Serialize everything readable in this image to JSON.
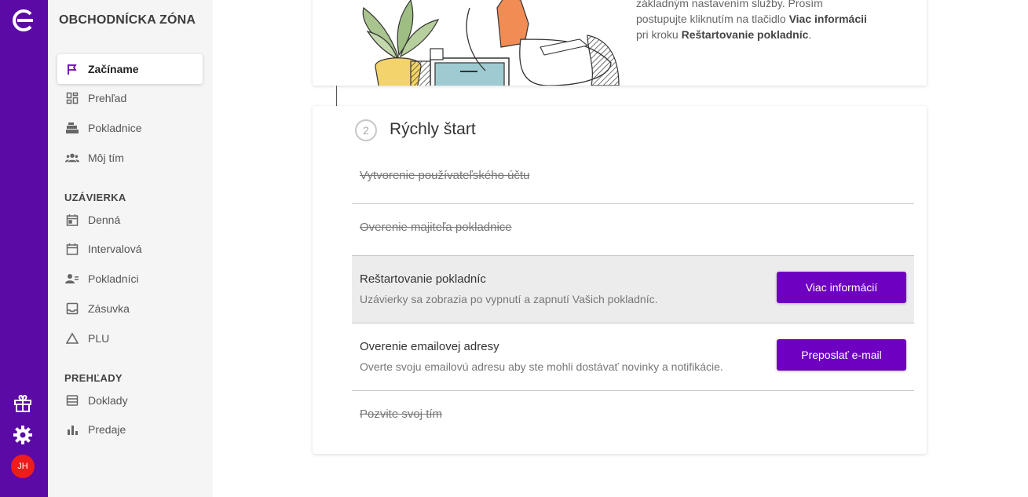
{
  "rail": {
    "icons": [
      "logo-icon",
      "gift-icon",
      "gear-icon"
    ],
    "avatar_initials": "JH",
    "avatar_color": "#ee1c1c",
    "rail_color": "#5b0aa6"
  },
  "sidebar": {
    "title": "OBCHODNÍCKA ZÓNA",
    "main_items": [
      {
        "label": "Začíname",
        "icon": "flag-icon",
        "active": true
      },
      {
        "label": "Prehľad",
        "icon": "dashboard-icon"
      },
      {
        "label": "Pokladnice",
        "icon": "cash-register-icon"
      },
      {
        "label": "Môj tím",
        "icon": "team-icon"
      }
    ],
    "closing_title": "UZÁVIERKA",
    "closing_items": [
      {
        "label": "Denná",
        "icon": "calendar-icon"
      },
      {
        "label": "Intervalová",
        "icon": "calendar-range-icon"
      },
      {
        "label": "Pokladníci",
        "icon": "cashiers-icon"
      },
      {
        "label": "Zásuvka",
        "icon": "drawer-icon"
      },
      {
        "label": "PLU",
        "icon": "triangle-icon"
      }
    ],
    "reports_title": "PREHĽADY",
    "reports_items": [
      {
        "label": "Doklady",
        "icon": "receipts-icon"
      },
      {
        "label": "Predaje",
        "icon": "bar-chart-icon"
      }
    ]
  },
  "intro_card": {
    "line1": "základným nastavením služby. Prosím",
    "line2_pre": "postupujte kliknutím na tlačidlo ",
    "line2_bold": "Viac informácii",
    "line3_pre": "pri kroku ",
    "line3_bold": "Reštartovanie pokladníc",
    "line3_post": "."
  },
  "quick_start": {
    "step_number": "2",
    "title": "Rýchly štart",
    "steps": [
      {
        "label": "Vytvorenie používateľského účtu",
        "done": true
      },
      {
        "label": "Overenie majiteľa pokladnice",
        "done": true
      },
      {
        "label": "Reštartovanie pokladníc",
        "description": "Uzávierky sa zobrazia po vypnutí a zapnutí Vašich pokladníc.",
        "button": "Viac informácií",
        "highlighted": true
      },
      {
        "label": "Overenie emailovej adresy",
        "description": "Overte svoju emailovú adresu aby ste mohli dostávať novinky a notifikácie.",
        "button": "Preposlať e-mail"
      },
      {
        "label": "Pozvite svoj tím",
        "done": true
      }
    ],
    "button_color": "#6d00c1"
  }
}
